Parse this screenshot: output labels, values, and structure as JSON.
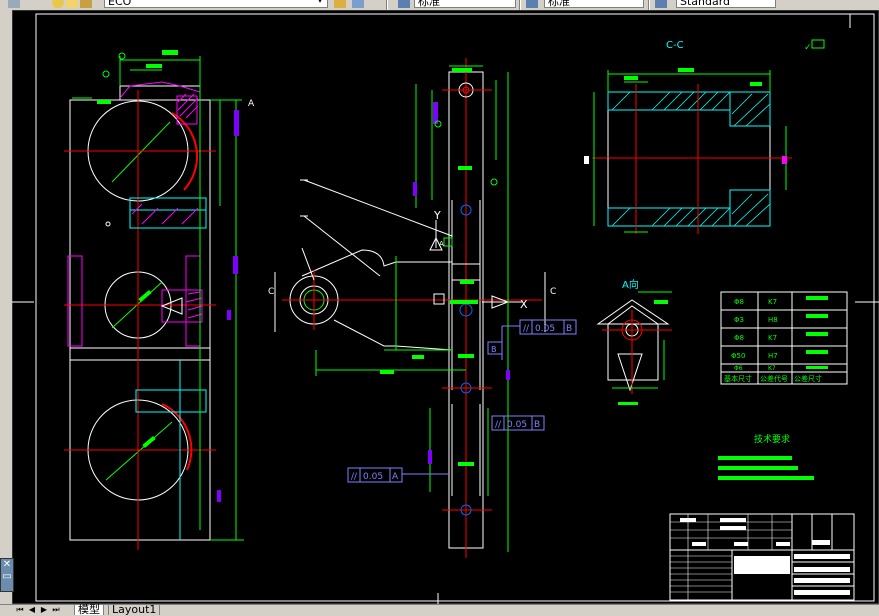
{
  "toolbar": {
    "layer_value": "ECO",
    "text_style_value": "标准",
    "dim_style_value": "标准",
    "table_style_value": "Standard"
  },
  "drawing": {
    "section_title": "C-C",
    "view_title": "A向",
    "section_mark_c": "C",
    "axis_x": "X",
    "axis_y": "Y",
    "datum_a": "A",
    "datum_b": "B",
    "tolerance_1": "0.05",
    "tolerance_1_datum": "B",
    "tolerance_2": "0.05",
    "tolerance_2_datum": "B",
    "tolerance_3": "0.05",
    "tolerance_3_datum": "A",
    "tech_title": "技术要求",
    "fit_table": {
      "rows": [
        {
          "size": "Φ8",
          "code": "K7"
        },
        {
          "size": "Φ3",
          "code": "H8"
        },
        {
          "size": "Φ8",
          "code": "K7"
        },
        {
          "size": "Φ50",
          "code": "H7"
        },
        {
          "size": "Φ6",
          "code": "K7"
        }
      ],
      "footer": [
        "基本尺寸",
        "公差代号",
        "公差尺寸"
      ]
    }
  },
  "tabs": [
    {
      "label": "模型",
      "active": true
    },
    {
      "label": "Layout1",
      "active": false
    }
  ],
  "colors": {
    "canvas": "#000000",
    "white": "#ffffff",
    "red": "#ff0000",
    "green": "#00ff00",
    "cyan": "#00ffff",
    "magenta": "#ff00ff",
    "purple": "#8000ff",
    "blue": "#0000ff",
    "yellow": "#ffff00"
  }
}
